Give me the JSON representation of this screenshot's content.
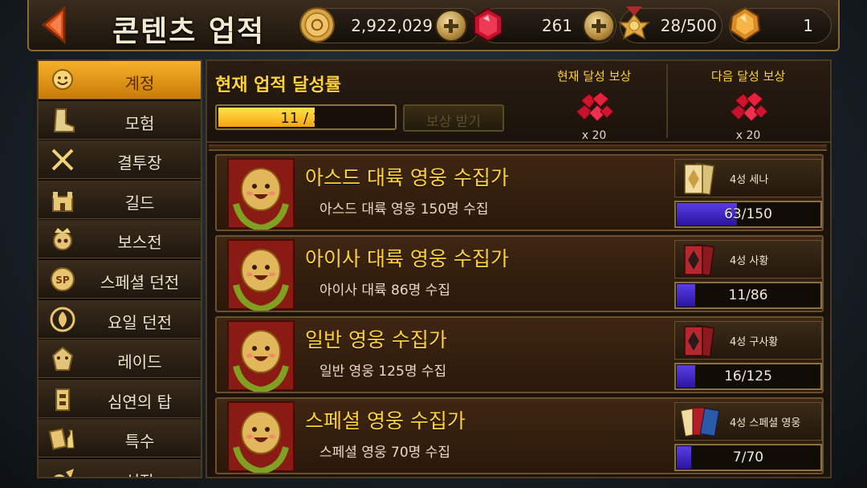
{
  "header": {
    "title": "콘텐츠 업적",
    "gold": "2,922,029",
    "gems": "261",
    "medals": "28/500",
    "crystals": "1"
  },
  "sidebar": {
    "items": [
      {
        "label": "계정",
        "icon": "smiley-face-icon",
        "active": true
      },
      {
        "label": "모험",
        "icon": "boot-icon",
        "active": false
      },
      {
        "label": "결투장",
        "icon": "crossed-swords-icon",
        "active": false
      },
      {
        "label": "길드",
        "icon": "castle-icon",
        "active": false
      },
      {
        "label": "보스전",
        "icon": "skull-crown-icon",
        "active": false
      },
      {
        "label": "스페셜 던전",
        "icon": "sp-badge-icon",
        "active": false
      },
      {
        "label": "요일 던전",
        "icon": "swirl-icon",
        "active": false
      },
      {
        "label": "레이드",
        "icon": "dragon-head-icon",
        "active": false
      },
      {
        "label": "심연의 탑",
        "icon": "tower-icon",
        "active": false
      },
      {
        "label": "특수",
        "icon": "cards-chess-icon",
        "active": false
      },
      {
        "label": "성장",
        "icon": "growth-icon",
        "active": false
      }
    ]
  },
  "summary": {
    "title": "현재 업적 달성률",
    "progress_text": "11 / 20",
    "progress_fraction": 0.55,
    "claim_label": "보상 받기",
    "current_reward_title": "현재 달성 보상",
    "current_reward_qty": "x 20",
    "next_reward_title": "다음 달성 보상",
    "next_reward_qty": "x 20"
  },
  "achievements": [
    {
      "name": "아스드 대륙 영웅 수집가",
      "desc": "아스드 대륙 영웅 150명 수집",
      "reward": "4성 세나",
      "progress": "63/150",
      "fraction": 0.42,
      "card": "gold"
    },
    {
      "name": "아이사 대륙 영웅 수집가",
      "desc": "아이사 대륙 86명 수집",
      "reward": "4성 사황",
      "progress": "11/86",
      "fraction": 0.128,
      "card": "red"
    },
    {
      "name": "일반 영웅 수집가",
      "desc": "일반 영웅 125명 수집",
      "reward": "4성 구사황",
      "progress": "16/125",
      "fraction": 0.128,
      "card": "red"
    },
    {
      "name": "스페셜 영웅 수집가",
      "desc": "스페셜 영웅 70명 수집",
      "reward": "4성 스페셜 영웅",
      "progress": "7/70",
      "fraction": 0.1,
      "card": "mixed"
    }
  ],
  "colors": {
    "accent_orange": "#f6b12a",
    "title_yellow": "#ffd23a",
    "progress_purple": "#4a30d0"
  }
}
